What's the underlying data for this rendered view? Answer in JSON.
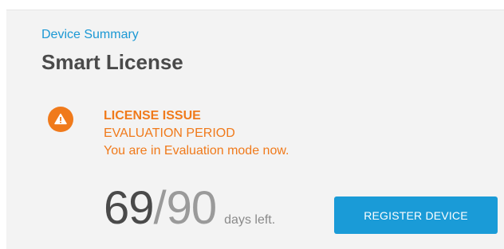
{
  "breadcrumb": {
    "label": "Device Summary"
  },
  "page": {
    "title": "Smart License"
  },
  "alert": {
    "icon": "warning-icon",
    "heading": "LICENSE ISSUE",
    "subheading": "EVALUATION PERIOD",
    "description": "You are in Evaluation mode now."
  },
  "evaluation": {
    "days_used": "69",
    "separator": "/",
    "days_total": "90",
    "suffix": "days left."
  },
  "actions": {
    "register_label": "REGISTER DEVICE"
  },
  "colors": {
    "accent": "#1b98d4",
    "warning": "#f07a1b",
    "button": "#1a9bd7",
    "panel_background": "#f3f3f3"
  }
}
